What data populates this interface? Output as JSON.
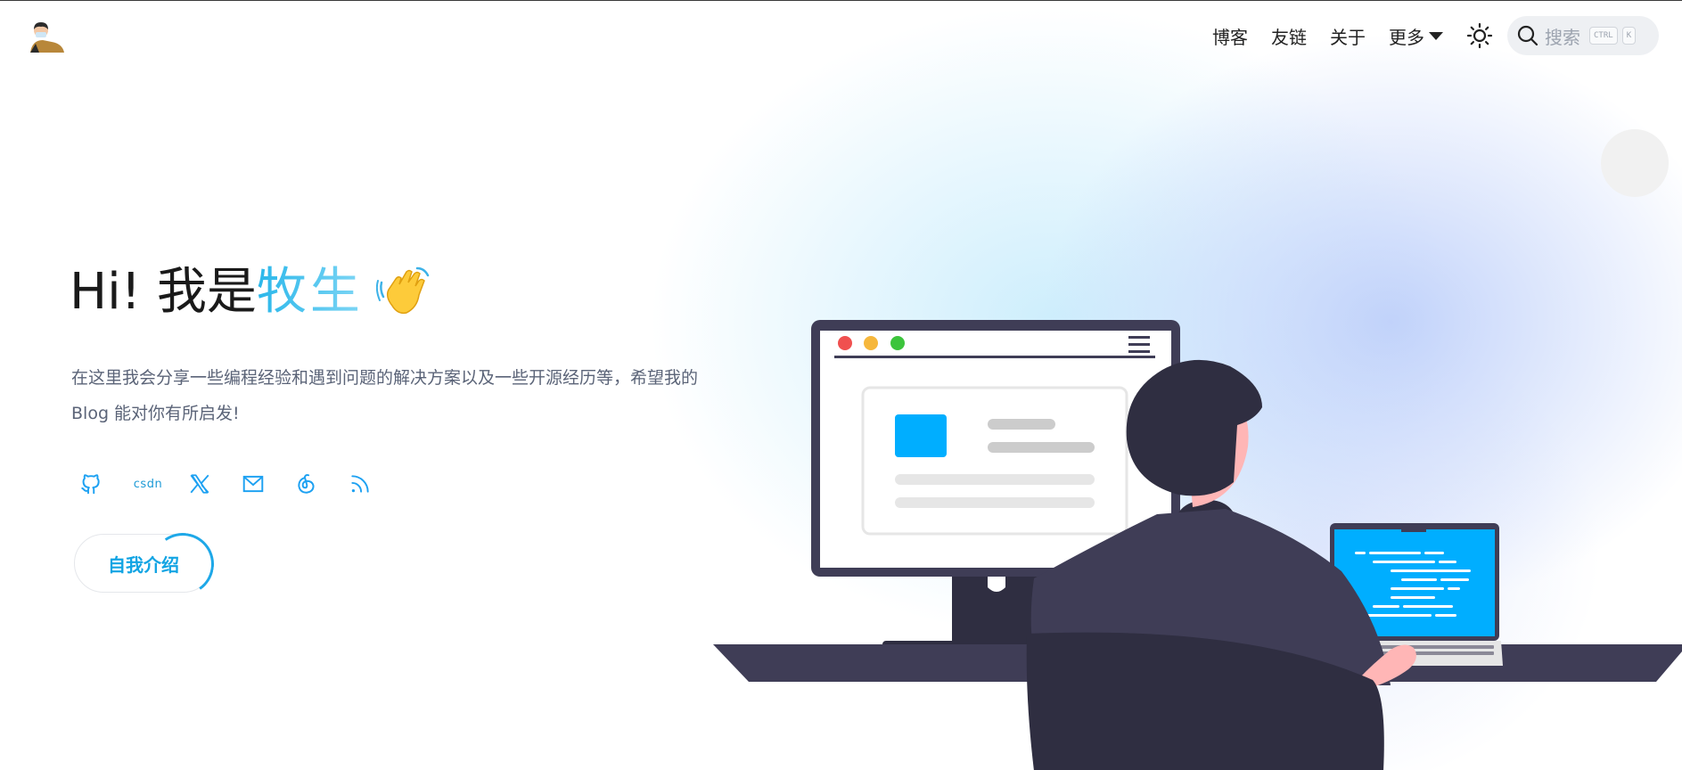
{
  "header": {
    "nav": [
      {
        "label": "博客"
      },
      {
        "label": "友链"
      },
      {
        "label": "关于"
      },
      {
        "label": "更多"
      }
    ],
    "search": {
      "placeholder": "搜索",
      "shortcut_keys": [
        "CTRL",
        "K"
      ]
    },
    "icons": [
      "avatar-logo",
      "sun-theme-icon",
      "search-icon",
      "chevron-down-icon"
    ]
  },
  "hero": {
    "greeting": "Hi! 我是",
    "name": "牧生",
    "description": "在这里我会分享一些编程经验和遇到问题的解决方案以及一些开源经历等，希望我的 Blog 能对你有所启发!",
    "socials": [
      {
        "name": "github-icon"
      },
      {
        "name": "csdn-icon",
        "text": "csdn"
      },
      {
        "name": "x-icon"
      },
      {
        "name": "mail-icon"
      },
      {
        "name": "netease-music-icon"
      },
      {
        "name": "rss-icon"
      }
    ],
    "cta_label": "自我介绍"
  },
  "colors": {
    "accent": "#1ea8e8",
    "name_gradient_start": "#2ab7ea",
    "name_gradient_end": "#7fd6f5",
    "illustration_dark": "#3f3d56",
    "illustration_blue": "#00aeff",
    "desc_text": "#5b6478"
  }
}
